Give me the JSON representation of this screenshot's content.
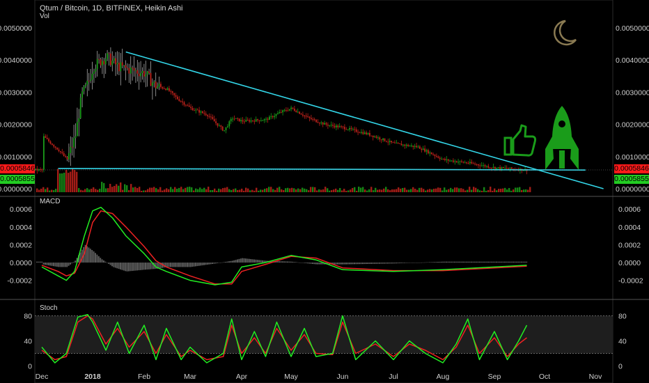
{
  "header": {
    "title": "Qtum / Bitcoin, 1D, BITFINEX, Heikin Ashi",
    "vol_label": "Vol",
    "macd_label": "MACD",
    "stoch_label": "Stoch"
  },
  "colors": {
    "background": "#000000",
    "up": "#1a9c1a",
    "down": "#c0221b",
    "trendline": "#33d6e8",
    "macd_line": "#22ee22",
    "signal_line": "#ee2222",
    "stoch_k": "#22ee22",
    "stoch_d": "#ee2222",
    "moon": "#8a7a52",
    "rocket": "#1a9c1a"
  },
  "price_tags": {
    "last": "0.0005846",
    "last_color": "#ff1a1a",
    "level": "0.0005855",
    "level_color": "#22cc22"
  },
  "icons": [
    "moon-icon",
    "thumbs-up-icon",
    "rocket-icon"
  ],
  "chart_data": [
    {
      "type": "candlestick",
      "title": "Qtum / Bitcoin, 1D, BITFINEX, Heikin Ashi",
      "x_tick_labels": [
        "Dec",
        "2018",
        "Feb",
        "Mar",
        "Apr",
        "May",
        "Jun",
        "Jul",
        "Aug",
        "Sep",
        "Oct",
        "Nov"
      ],
      "y_tick_labels": [
        "0.0050000",
        "0.0040000",
        "0.0030000",
        "0.0020000",
        "0.0010000",
        "0.0000000"
      ],
      "ylim": [
        0,
        0.0051
      ],
      "close_path": [
        [
          "Dec",
          0.00165
        ],
        [
          "Dec 10",
          0.0012
        ],
        [
          "Dec 15",
          0.0009
        ],
        [
          "Dec 20",
          0.0016
        ],
        [
          "Dec 24",
          0.0029
        ],
        [
          "Dec 28",
          0.0033
        ],
        [
          "2018",
          0.0038
        ],
        [
          "Jan 08",
          0.0041
        ],
        [
          "Jan 15",
          0.0038
        ],
        [
          "Jan 22",
          0.0037
        ],
        [
          "Feb",
          0.0036
        ],
        [
          "Feb 07",
          0.0032
        ],
        [
          "Feb 15",
          0.0031
        ],
        [
          "Feb 22",
          0.0028
        ],
        [
          "Mar",
          0.0025
        ],
        [
          "Mar 10",
          0.0023
        ],
        [
          "Mar 20",
          0.0018
        ],
        [
          "Mar 25",
          0.0022
        ],
        [
          "Apr",
          0.0021
        ],
        [
          "Apr 15",
          0.00215
        ],
        [
          "Apr 25",
          0.0024
        ],
        [
          "May",
          0.0025
        ],
        [
          "May 10",
          0.0022
        ],
        [
          "May 20",
          0.002
        ],
        [
          "Jun",
          0.0019
        ],
        [
          "Jun 15",
          0.0017
        ],
        [
          "Jul",
          0.0014
        ],
        [
          "Jul 15",
          0.0013
        ],
        [
          "Aug",
          0.0009
        ],
        [
          "Aug 15",
          0.0008
        ],
        [
          "Sep",
          0.00065
        ],
        [
          "Sep 15",
          0.0006
        ],
        [
          "Sep 20",
          0.000585
        ]
      ],
      "trendlines": [
        {
          "from": [
            "Jan 20",
            0.00425
          ],
          "to": [
            "Nov 05",
            0.0
          ]
        },
        {
          "from": [
            "Dec 10",
            0.00063
          ],
          "to": [
            "Oct 25",
            0.00058
          ]
        }
      ],
      "last_price": 0.0005846
    },
    {
      "type": "bar",
      "title": "Vol",
      "note": "volume histogram, red/green by candle direction"
    },
    {
      "type": "line",
      "title": "MACD",
      "y_tick_labels": [
        "0.0006",
        "0.0004",
        "0.0002",
        "0.0000",
        "-0.0002"
      ],
      "ylim": [
        -0.00032,
        0.00068
      ],
      "series": [
        {
          "name": "MACD",
          "values": [
            [
              "Dec",
              -5e-05
            ],
            [
              "Dec 10",
              -0.00015
            ],
            [
              "Dec 15",
              -0.0002
            ],
            [
              "Dec 20",
              -0.0001
            ],
            [
              "Dec 26",
              0.0003
            ],
            [
              "2018",
              0.00058
            ],
            [
              "Jan 05",
              0.00062
            ],
            [
              "Jan 12",
              0.0005
            ],
            [
              "Jan 20",
              0.0003
            ],
            [
              "Feb",
              0.0001
            ],
            [
              "Feb 08",
              -5e-05
            ],
            [
              "Feb 15",
              -0.0001
            ],
            [
              "Mar",
              -0.0002
            ],
            [
              "Mar 15",
              -0.00025
            ],
            [
              "Mar 25",
              -0.00022
            ],
            [
              "Apr",
              -5e-05
            ],
            [
              "Apr 15",
              0.0
            ],
            [
              "May",
              8e-05
            ],
            [
              "May 15",
              3e-05
            ],
            [
              "Jun",
              -8e-05
            ],
            [
              "Jul",
              -0.0001
            ],
            [
              "Aug",
              -8e-05
            ],
            [
              "Sep",
              -5e-05
            ],
            [
              "Sep 20",
              -3e-05
            ]
          ]
        },
        {
          "name": "Signal",
          "values": [
            [
              "Dec",
              -3e-05
            ],
            [
              "Dec 10",
              -0.0001
            ],
            [
              "Dec 15",
              -0.00015
            ],
            [
              "Dec 20",
              -0.00012
            ],
            [
              "Dec 26",
              0.0001
            ],
            [
              "2018",
              0.00045
            ],
            [
              "Jan 05",
              0.00058
            ],
            [
              "Jan 12",
              0.00055
            ],
            [
              "Jan 20",
              0.0004
            ],
            [
              "Feb",
              0.00018
            ],
            [
              "Feb 08",
              2e-05
            ],
            [
              "Feb 15",
              -5e-05
            ],
            [
              "Mar",
              -0.00015
            ],
            [
              "Mar 15",
              -0.00024
            ],
            [
              "Mar 25",
              -0.00024
            ],
            [
              "Apr",
              -0.0001
            ],
            [
              "Apr 15",
              -2e-05
            ],
            [
              "May",
              7e-05
            ],
            [
              "May 15",
              5e-05
            ],
            [
              "Jun",
              -6e-05
            ],
            [
              "Jul",
              -9e-05
            ],
            [
              "Aug",
              -9e-05
            ],
            [
              "Sep",
              -6e-05
            ],
            [
              "Sep 20",
              -4e-05
            ]
          ]
        }
      ]
    },
    {
      "type": "line",
      "title": "Stoch",
      "y_tick_labels": [
        "80",
        "40",
        "0"
      ],
      "ylim": [
        -5,
        95
      ],
      "bands": [
        20,
        80
      ],
      "series": [
        {
          "name": "%K",
          "values": [
            [
              "Dec",
              30
            ],
            [
              "Dec 08",
              5
            ],
            [
              "Dec 15",
              20
            ],
            [
              "Dec 22",
              78
            ],
            [
              "Dec 28",
              82
            ],
            [
              "2018",
              70
            ],
            [
              "Jan 08",
              25
            ],
            [
              "Jan 15",
              70
            ],
            [
              "Jan 22",
              20
            ],
            [
              "Feb",
              65
            ],
            [
              "Feb 08",
              10
            ],
            [
              "Feb 15",
              60
            ],
            [
              "Feb 25",
              10
            ],
            [
              "Mar",
              30
            ],
            [
              "Mar 10",
              5
            ],
            [
              "Mar 20",
              20
            ],
            [
              "Mar 25",
              75
            ],
            [
              "Apr",
              10
            ],
            [
              "Apr 08",
              55
            ],
            [
              "Apr 15",
              15
            ],
            [
              "Apr 22",
              70
            ],
            [
              "May",
              15
            ],
            [
              "May 08",
              60
            ],
            [
              "May 15",
              15
            ],
            [
              "May 25",
              20
            ],
            [
              "Jun",
              80
            ],
            [
              "Jun 08",
              10
            ],
            [
              "Jun 20",
              40
            ],
            [
              "Jul",
              10
            ],
            [
              "Jul 10",
              40
            ],
            [
              "Jul 20",
              20
            ],
            [
              "Aug",
              5
            ],
            [
              "Aug 08",
              35
            ],
            [
              "Aug 15",
              75
            ],
            [
              "Aug 22",
              10
            ],
            [
              "Sep",
              55
            ],
            [
              "Sep 08",
              10
            ],
            [
              "Sep 15",
              40
            ],
            [
              "Sep 20",
              65
            ]
          ]
        },
        {
          "name": "%D",
          "values": [
            [
              "Dec",
              25
            ],
            [
              "Dec 08",
              10
            ],
            [
              "Dec 15",
              15
            ],
            [
              "Dec 22",
              70
            ],
            [
              "Dec 28",
              80
            ],
            [
              "2018",
              75
            ],
            [
              "Jan 08",
              35
            ],
            [
              "Jan 15",
              60
            ],
            [
              "Jan 22",
              30
            ],
            [
              "Feb",
              55
            ],
            [
              "Feb 08",
              20
            ],
            [
              "Feb 15",
              50
            ],
            [
              "Feb 25",
              15
            ],
            [
              "Mar",
              25
            ],
            [
              "Mar 10",
              10
            ],
            [
              "Mar 20",
              15
            ],
            [
              "Mar 25",
              65
            ],
            [
              "Apr",
              20
            ],
            [
              "Apr 08",
              45
            ],
            [
              "Apr 15",
              20
            ],
            [
              "Apr 22",
              60
            ],
            [
              "May",
              25
            ],
            [
              "May 08",
              50
            ],
            [
              "May 15",
              20
            ],
            [
              "May 25",
              18
            ],
            [
              "Jun",
              70
            ],
            [
              "Jun 08",
              20
            ],
            [
              "Jun 20",
              35
            ],
            [
              "Jul",
              15
            ],
            [
              "Jul 10",
              35
            ],
            [
              "Jul 20",
              25
            ],
            [
              "Aug",
              10
            ],
            [
              "Aug 08",
              30
            ],
            [
              "Aug 15",
              65
            ],
            [
              "Aug 22",
              20
            ],
            [
              "Sep",
              45
            ],
            [
              "Sep 08",
              15
            ],
            [
              "Sep 15",
              35
            ],
            [
              "Sep 20",
              45
            ]
          ]
        }
      ]
    }
  ]
}
